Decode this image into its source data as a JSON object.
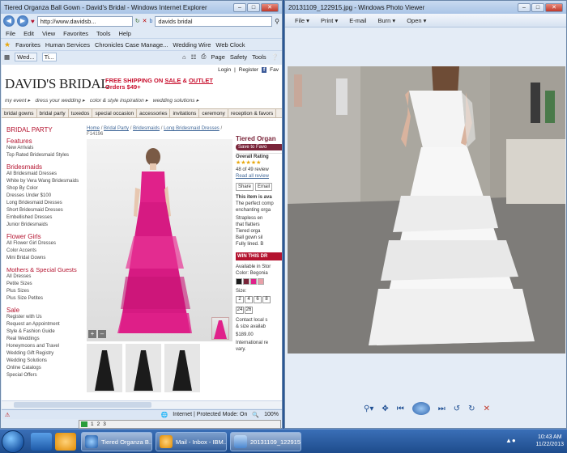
{
  "ie": {
    "title": "Tiered Organza Ball Gown - David's Bridal - Windows Internet Explorer",
    "address": "http://www.davidsb...",
    "search": "davids bridal",
    "menu": [
      "File",
      "Edit",
      "View",
      "Favorites",
      "Tools",
      "Help"
    ],
    "favorites_label": "Favorites",
    "fav_links": [
      "Human Services",
      "Chronicles Case Manage...",
      "Wedding Wire",
      "Web Clock"
    ],
    "tabs": [
      "Wed...",
      "Ti..."
    ],
    "commands": [
      "Page",
      "Safety",
      "Tools"
    ],
    "status": "Internet | Protected Mode: On",
    "zoom": "100%"
  },
  "site": {
    "util": [
      "Login",
      "|",
      "Register",
      "Fav"
    ],
    "logo": "DAVID'S BRIDAL",
    "promo_line1_a": "FREE SHIPPING ON ",
    "promo_sale": "SALE",
    "promo_and": " & ",
    "promo_outlet": "OUTLET",
    "promo_line2": "Orders $49+",
    "subnav": [
      "my event ▸",
      "dress your wedding ▸",
      "color & style inspiration ▸",
      "wedding solutions ▸"
    ],
    "categories": [
      "bridal gowns",
      "bridal party",
      "tuxedos",
      "special occasion",
      "accessories",
      "invitations",
      "ceremony",
      "reception & favors"
    ],
    "sidebar": [
      {
        "heading": "BRIDAL PARTY",
        "items": []
      },
      {
        "heading": "Features",
        "items": [
          "New Arrivals",
          "Top Rated Bridesmaid Styles"
        ]
      },
      {
        "heading": "Bridesmaids",
        "items": [
          "All Bridesmaid Dresses",
          "White by Vera Wang Bridesmaids",
          "Shop By Color",
          "Dresses Under $100",
          "Long Bridesmaid Dresses",
          "Short Bridesmaid Dresses",
          "Embellished Dresses",
          "Junior Bridesmaids"
        ]
      },
      {
        "heading": "Flower Girls",
        "items": [
          "All Flower Girl Dresses",
          "Color Accents",
          "Mini Bridal Gowns"
        ]
      },
      {
        "heading": "Mothers & Special Guests",
        "items": [
          "All Dresses",
          "Petite Sizes",
          "Plus Sizes",
          "Plus Size Petites"
        ]
      },
      {
        "heading": "Sale",
        "items": [
          "Register with Us",
          "Request an Appointment",
          "Style & Fashion Guide",
          "Real Weddings",
          "Honeymoons and Travel",
          "Wedding Gift Registry",
          "Wedding Solutions",
          "Online Catalogs",
          "Special Offers"
        ]
      }
    ],
    "breadcrumb": [
      "Home",
      "/",
      "Bridal Party",
      "/",
      "Bridesmaids",
      "/",
      "Long Bridesmaid Dresses",
      "/"
    ],
    "sku": "F14196",
    "product": {
      "title": "Tiered Organ",
      "save": "Save to Favo",
      "overall": "Overall Rating",
      "reviews": "48 of 49 review",
      "read_all": "Read all review",
      "share": "Share",
      "email": "Email",
      "avail": "This item is ava",
      "desc1": "The perfect comp",
      "desc2": "enchanting orga",
      "bullets": [
        "Strapless en",
        "that flatters",
        "Tiered orga",
        "Ball gown sil",
        "Fully lined. B"
      ],
      "win": "WIN THIS DR",
      "available": "Available in Stor",
      "color_label": "Color: Begonia",
      "size_label": "Size:",
      "sizes1": [
        "2",
        "4",
        "6",
        "8"
      ],
      "sizes2": [
        "24",
        "26"
      ],
      "contact1": "Contact local s",
      "contact2": "& size availab",
      "price": "$189.00",
      "intl1": "International re",
      "intl2": "vary."
    }
  },
  "pv": {
    "title": "20131109_122915.jpg - Windows Photo Viewer",
    "menu": [
      "File ▾",
      "Print ▾",
      "E-mail",
      "Burn ▾",
      "Open ▾"
    ]
  },
  "taskbar": {
    "tasks": [
      "Tiered Organza B...",
      "Mail - Inbox - IBM...",
      "20131109_122915.jpg..."
    ],
    "time": "10:43 AM",
    "date": "11/22/2013"
  },
  "colors": {
    "accent": "#c8102e",
    "dress_pink": "#e0218a",
    "link": "#436a9a"
  }
}
